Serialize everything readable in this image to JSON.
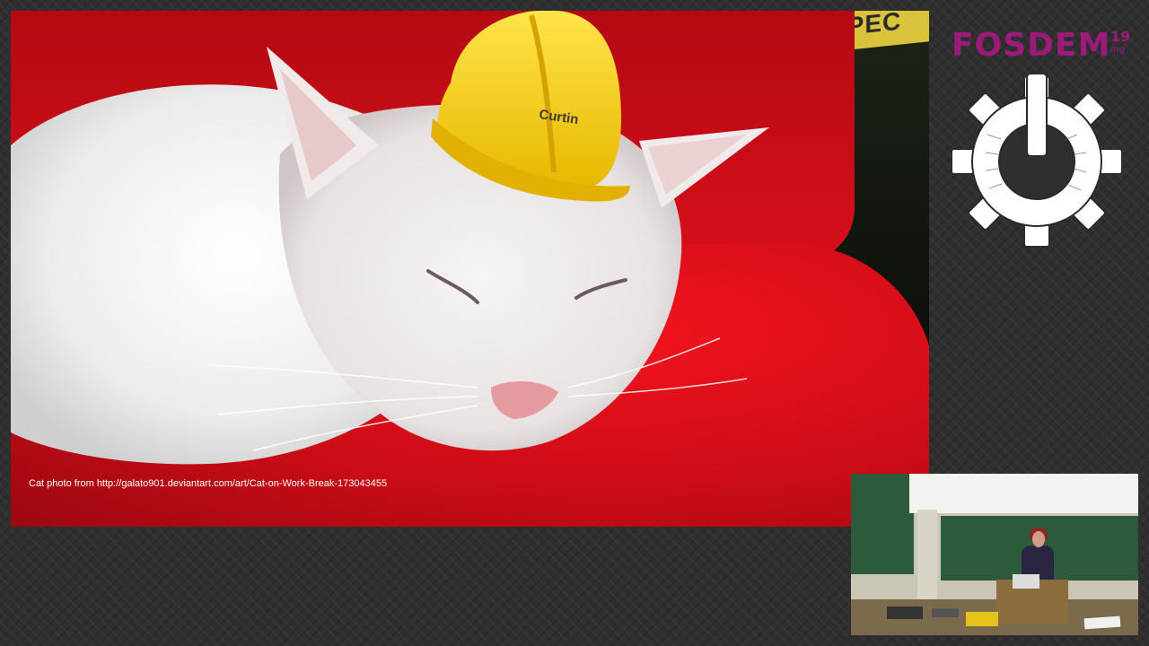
{
  "slide": {
    "caption": "Cat photo from http://galato901.deviantart.com/art/Cat-on-Work-Break-173043455",
    "helmet_text": "Curtin",
    "background_sign": "SPEC"
  },
  "branding": {
    "logo_text": "FOSDEM",
    "year": "19",
    "tld": "org",
    "gear_icon": "fosdem-gear-power-icon",
    "logo_color": "#9b1a7a"
  },
  "video_inset": {
    "description": "speaker-camera"
  },
  "colors": {
    "slide_red": "#d70f19",
    "background": "#2f2f2f"
  }
}
